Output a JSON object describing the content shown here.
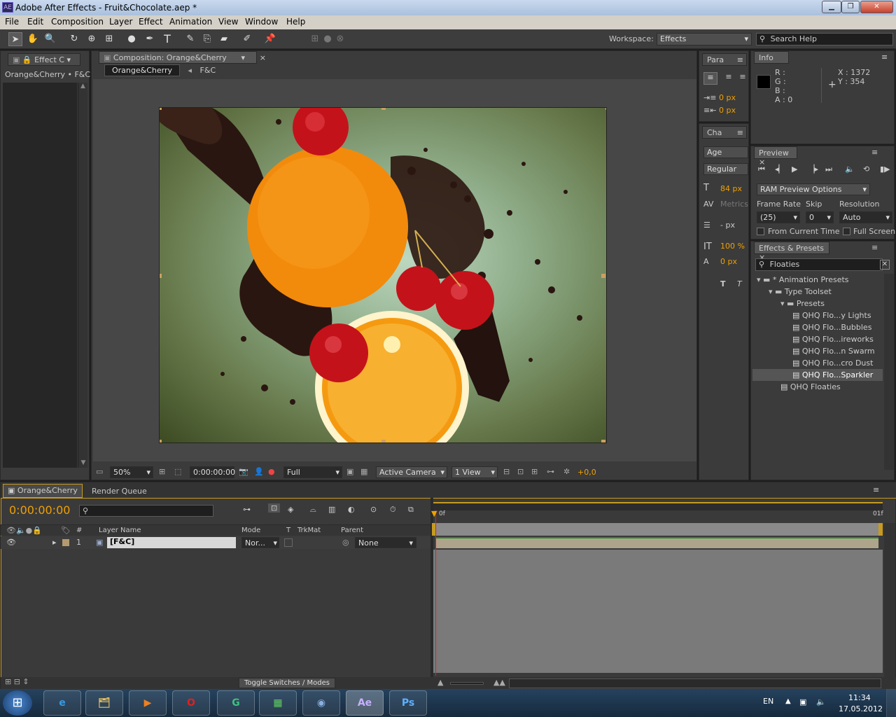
{
  "window": {
    "title": "Adobe After Effects - Fruit&Chocolate.aep *",
    "app_icon": "AE"
  },
  "menu": [
    "File",
    "Edit",
    "Composition",
    "Layer",
    "Effect",
    "Animation",
    "View",
    "Window",
    "Help"
  ],
  "toolbar": {
    "workspace_label": "Workspace:",
    "workspace_value": "Effects",
    "search_placeholder": "Search Help"
  },
  "effect_controls": {
    "tab": "Effect C",
    "subtitle": "Orange&Cherry • F&C"
  },
  "composition": {
    "tab": "Composition: Orange&Cherry",
    "crumb_active": "Orange&Cherry",
    "crumb_other": "F&C",
    "zoom": "50%",
    "timecode": "0:00:00:00",
    "resolution": "Full",
    "camera": "Active Camera",
    "views": "1 View",
    "exposure": "+0,0"
  },
  "paragraph": {
    "tab": "Para",
    "indent_before": "0 px",
    "indent_after": "0 px"
  },
  "character": {
    "tab": "Cha",
    "font": "Age",
    "style": "Regular",
    "size": "84 px",
    "kerning": "Metrics",
    "leading": "- px",
    "vscale": "100 %",
    "baseline": "0 px"
  },
  "info": {
    "tab": "Info",
    "r": "R :",
    "g": "G :",
    "b": "B :",
    "a": "A : 0",
    "x": "X : 1372",
    "y": "Y : 354"
  },
  "preview": {
    "tab": "Preview",
    "ram_options": "RAM Preview Options",
    "frame_rate_label": "Frame Rate",
    "skip_label": "Skip",
    "resolution_label": "Resolution",
    "frame_rate": "(25)",
    "skip": "0",
    "resolution": "Auto",
    "from_current": "From Current Time",
    "full_screen": "Full Screen"
  },
  "effects_presets": {
    "tab": "Effects & Presets",
    "search": "Floaties",
    "tree": [
      {
        "label": "* Animation Presets",
        "level": 0,
        "kind": "folder"
      },
      {
        "label": "Type Toolset",
        "level": 1,
        "kind": "folder"
      },
      {
        "label": "Presets",
        "level": 2,
        "kind": "folder"
      },
      {
        "label": "QHQ Flo...y Lights",
        "level": 3,
        "kind": "preset"
      },
      {
        "label": "QHQ Flo...Bubbles",
        "level": 3,
        "kind": "preset"
      },
      {
        "label": "QHQ Flo...ireworks",
        "level": 3,
        "kind": "preset"
      },
      {
        "label": "QHQ Flo...n Swarm",
        "level": 3,
        "kind": "preset"
      },
      {
        "label": "QHQ Flo...cro Dust",
        "level": 3,
        "kind": "preset"
      },
      {
        "label": "QHQ Flo...Sparkler",
        "level": 3,
        "kind": "preset",
        "selected": true
      },
      {
        "label": "QHQ Floaties",
        "level": 2,
        "kind": "preset"
      }
    ]
  },
  "timeline": {
    "tab": "Orange&Cherry",
    "tab2": "Render Queue",
    "timecode": "0:00:00:00",
    "columns": {
      "layer_name": "Layer Name",
      "mode": "Mode",
      "t": "T",
      "trkmat": "TrkMat",
      "parent": "Parent",
      "num": "#"
    },
    "layers": [
      {
        "num": "1",
        "name": "[F&C]",
        "mode": "Nor...",
        "parent": "None"
      }
    ],
    "ruler_start": "0f",
    "ruler_end": "01f",
    "toggle_label": "Toggle Switches / Modes"
  },
  "taskbar": {
    "lang": "EN",
    "time": "11:34",
    "date": "17.05.2012",
    "apps": [
      "e",
      "🗂",
      "▶",
      "O",
      "G",
      "▦",
      "◉",
      "Ae",
      "Ps"
    ]
  },
  "colors": {
    "accent_orange": "#f0a000",
    "panel_bg": "#3b3b3b",
    "title_blue": "#c9d9ee"
  }
}
